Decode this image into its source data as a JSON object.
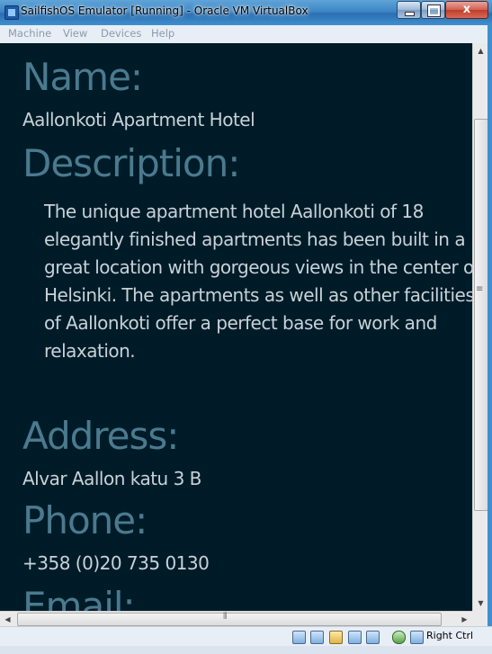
{
  "window": {
    "title": "SailfishOS Emulator [Running] - Oracle VM VirtualBox",
    "close_glyph": "x"
  },
  "menu": {
    "items": [
      {
        "label": "Machine"
      },
      {
        "label": "View"
      },
      {
        "label": "Devices"
      },
      {
        "label": "Help"
      }
    ]
  },
  "hotel": {
    "name_heading": "Name:",
    "name": "Aallonkoti Apartment Hotel",
    "description_heading": "Description:",
    "description": "The unique apartment hotel Aallonkoti of 18 elegantly finished apartments has been built in a great location with gorgeous views in the center of Helsinki. The apartments as well as other facilities of Aallonkoti offer a perfect base for work and relaxation.",
    "address_heading": "Address:",
    "address": "Alvar Aallon katu 3 B",
    "phone_heading": "Phone:",
    "phone": "+358 (0)20 735 0130",
    "email_heading": "Email:"
  },
  "statusbar": {
    "host_key": "Right Ctrl",
    "icons": [
      "hard-disk-icon",
      "network-icon",
      "shared-folder-icon",
      "display-icon",
      "usb-icon",
      "virtualization-icon",
      "mouse-integration-icon"
    ]
  },
  "colors": {
    "content_background": "#001b28",
    "heading": "#4a7a8e",
    "text": "#c7d2d8"
  }
}
